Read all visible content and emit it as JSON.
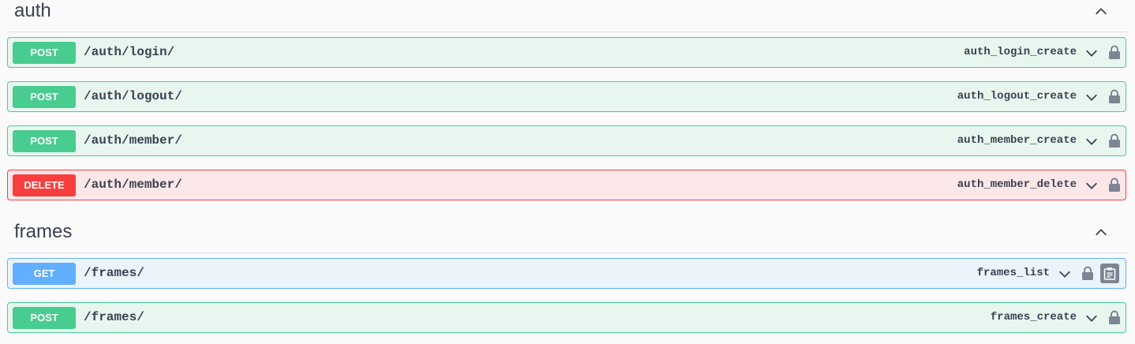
{
  "sections": [
    {
      "title": "auth",
      "operations": [
        {
          "method": "POST",
          "path": "/auth/login/",
          "operation_id": "auth_login_create"
        },
        {
          "method": "POST",
          "path": "/auth/logout/",
          "operation_id": "auth_logout_create"
        },
        {
          "method": "POST",
          "path": "/auth/member/",
          "operation_id": "auth_member_create"
        },
        {
          "method": "DELETE",
          "path": "/auth/member/",
          "operation_id": "auth_member_delete"
        }
      ]
    },
    {
      "title": "frames",
      "operations": [
        {
          "method": "GET",
          "path": "/frames/",
          "operation_id": "frames_list"
        },
        {
          "method": "POST",
          "path": "/frames/",
          "operation_id": "frames_create"
        }
      ]
    }
  ],
  "icons": {
    "section_toggle": "chevron-up-icon",
    "operation_toggle": "chevron-down-icon",
    "auth": "lock-icon",
    "copy": "clipboard-icon"
  },
  "colors": {
    "post": "#49cc90",
    "delete": "#f93e3e",
    "get": "#61affe",
    "text": "#3b4151"
  }
}
